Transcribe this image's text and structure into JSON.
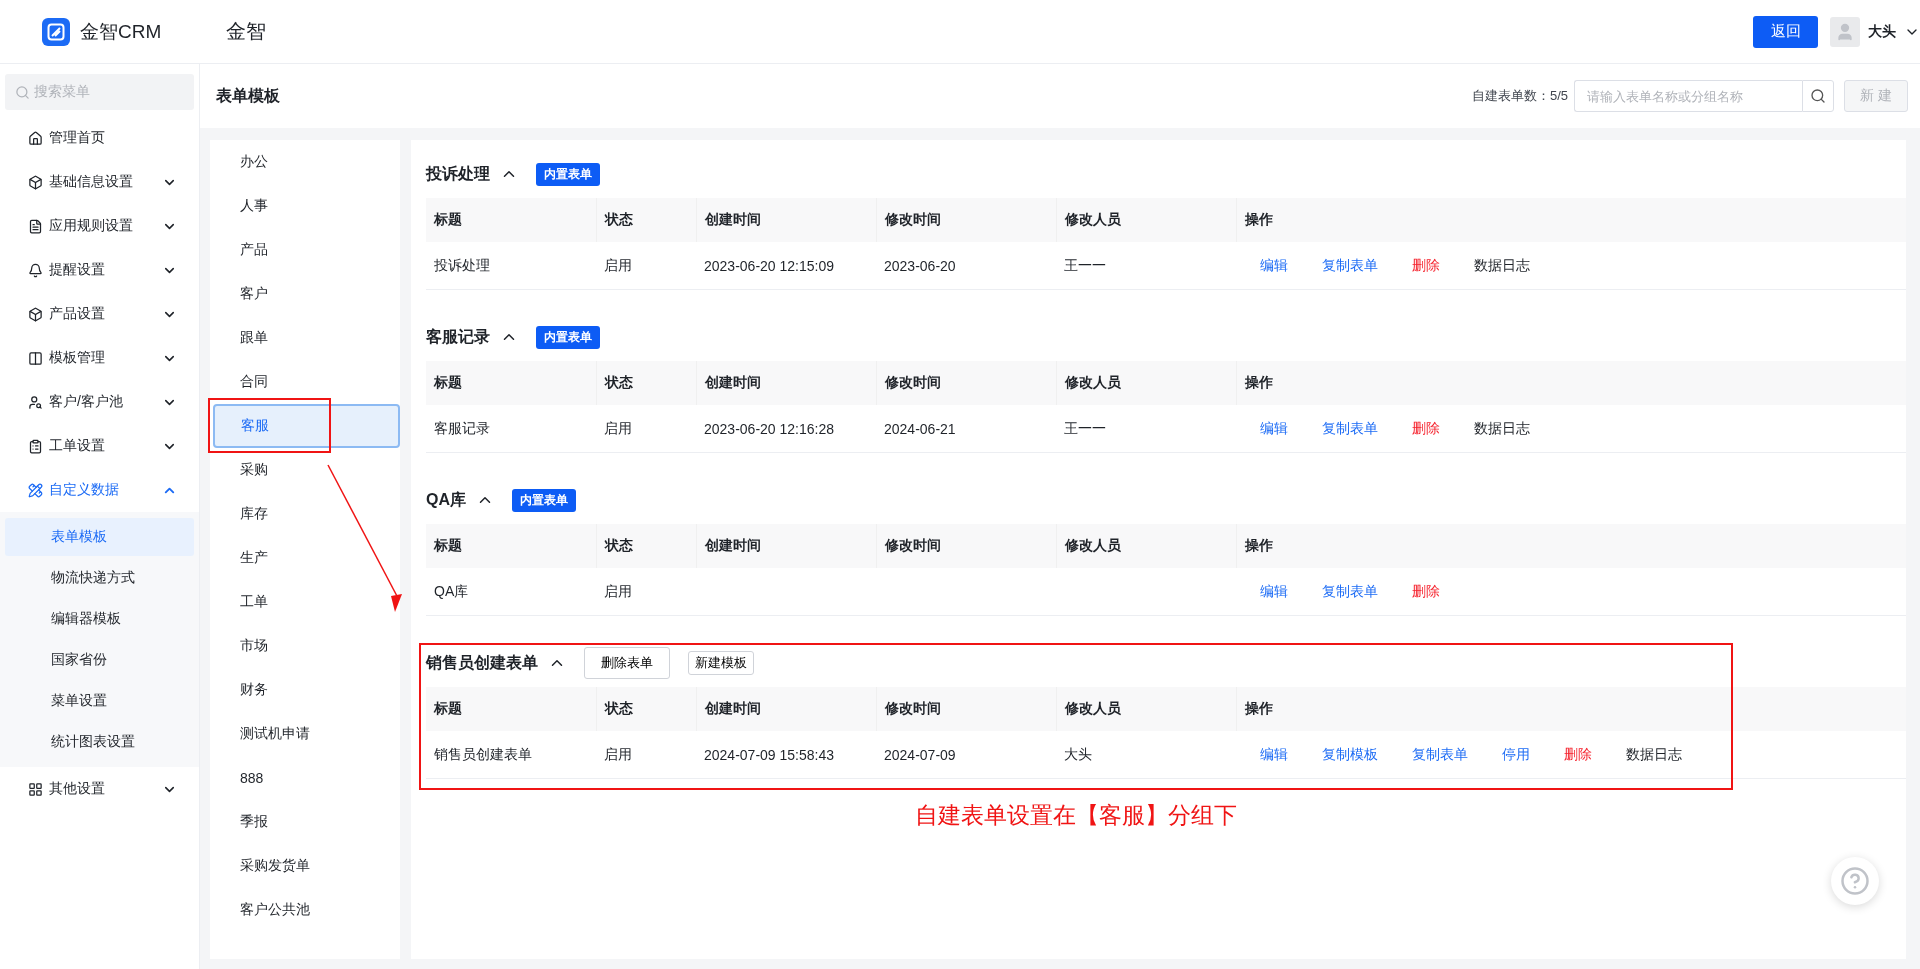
{
  "topbar": {
    "brand": "金智CRM",
    "title": "金智",
    "back_button": "返回",
    "user": "大头"
  },
  "sidebar": {
    "search_placeholder": "搜索菜单",
    "items": [
      {
        "label": "管理首页",
        "selected": false
      },
      {
        "label": "基础信息设置",
        "expanded": false,
        "selected": false
      },
      {
        "label": "应用规则设置",
        "expanded": false,
        "selected": false
      },
      {
        "label": "提醒设置",
        "expanded": false,
        "selected": false
      },
      {
        "label": "产品设置",
        "expanded": false,
        "selected": false
      },
      {
        "label": "模板管理",
        "expanded": false,
        "selected": false
      },
      {
        "label": "客户/客户池",
        "expanded": false,
        "selected": false
      },
      {
        "label": "工单设置",
        "expanded": false,
        "selected": false
      },
      {
        "label": "自定义数据",
        "expanded": true,
        "selected": true,
        "children": [
          {
            "label": "表单模板",
            "selected": true
          },
          {
            "label": "物流快递方式",
            "selected": false
          },
          {
            "label": "编辑器模板",
            "selected": false
          },
          {
            "label": "国家省份",
            "selected": false
          },
          {
            "label": "菜单设置",
            "selected": false
          },
          {
            "label": "统计图表设置",
            "selected": false
          }
        ]
      },
      {
        "label": "其他设置",
        "expanded": false,
        "selected": false
      }
    ]
  },
  "page": {
    "title": "表单模板",
    "count_label": "自建表单数：5/5",
    "search_placeholder": "请输入表单名称或分组名称",
    "new_button": "新 建",
    "new_disabled": true
  },
  "groups": [
    {
      "label": "办公",
      "selected": false
    },
    {
      "label": "人事",
      "selected": false
    },
    {
      "label": "产品",
      "selected": false
    },
    {
      "label": "客户",
      "selected": false
    },
    {
      "label": "跟单",
      "selected": false
    },
    {
      "label": "合同",
      "selected": false
    },
    {
      "label": "客服",
      "selected": true
    },
    {
      "label": "采购",
      "selected": false
    },
    {
      "label": "库存",
      "selected": false
    },
    {
      "label": "生产",
      "selected": false
    },
    {
      "label": "工单",
      "selected": false
    },
    {
      "label": "市场",
      "selected": false
    },
    {
      "label": "财务",
      "selected": false
    },
    {
      "label": "测试机申请",
      "selected": false
    },
    {
      "label": "888",
      "selected": false
    },
    {
      "label": "季报",
      "selected": false
    },
    {
      "label": "采购发货单",
      "selected": false
    },
    {
      "label": "客户公共池",
      "selected": false
    }
  ],
  "sections": [
    {
      "title": "投诉处理",
      "expanded": true,
      "badge": "内置表单",
      "columns": [
        "标题",
        "状态",
        "创建时间",
        "修改时间",
        "修改人员",
        "操作"
      ],
      "rows": [
        {
          "cells": [
            "投诉处理",
            "启用",
            "2023-06-20 12:15:09",
            "2023-06-20",
            "王一一"
          ],
          "actions": [
            {
              "label": "编辑",
              "kind": "link"
            },
            {
              "label": "复制表单",
              "kind": "link"
            },
            {
              "label": "删除",
              "kind": "danger"
            },
            {
              "label": "数据日志",
              "kind": "plain"
            }
          ]
        }
      ]
    },
    {
      "title": "客服记录",
      "expanded": true,
      "badge": "内置表单",
      "columns": [
        "标题",
        "状态",
        "创建时间",
        "修改时间",
        "修改人员",
        "操作"
      ],
      "rows": [
        {
          "cells": [
            "客服记录",
            "启用",
            "2023-06-20 12:16:28",
            "2024-06-21",
            "王一一"
          ],
          "actions": [
            {
              "label": "编辑",
              "kind": "link"
            },
            {
              "label": "复制表单",
              "kind": "link"
            },
            {
              "label": "删除",
              "kind": "danger"
            },
            {
              "label": "数据日志",
              "kind": "plain"
            }
          ]
        }
      ]
    },
    {
      "title": "QA库",
      "expanded": true,
      "badge": "内置表单",
      "columns": [
        "标题",
        "状态",
        "创建时间",
        "修改时间",
        "修改人员",
        "操作"
      ],
      "rows": [
        {
          "cells": [
            "QA库",
            "启用",
            "",
            "",
            ""
          ],
          "actions": [
            {
              "label": "编辑",
              "kind": "link"
            },
            {
              "label": "复制表单",
              "kind": "link"
            },
            {
              "label": "删除",
              "kind": "danger"
            }
          ]
        }
      ]
    },
    {
      "title": "销售员创建表单",
      "expanded": true,
      "buttons": [
        "删除表单",
        "新建模板"
      ],
      "columns": [
        "标题",
        "状态",
        "创建时间",
        "修改时间",
        "修改人员",
        "操作"
      ],
      "rows": [
        {
          "cells": [
            "销售员创建表单",
            "启用",
            "2024-07-09 15:58:43",
            "2024-07-09",
            "大头"
          ],
          "actions": [
            {
              "label": "编辑",
              "kind": "link"
            },
            {
              "label": "复制模板",
              "kind": "link"
            },
            {
              "label": "复制表单",
              "kind": "link"
            },
            {
              "label": "停用",
              "kind": "link"
            },
            {
              "label": "删除",
              "kind": "danger"
            },
            {
              "label": "数据日志",
              "kind": "plain"
            }
          ]
        }
      ]
    }
  ],
  "annotation": {
    "note": "自建表单设置在【客服】分组下"
  }
}
